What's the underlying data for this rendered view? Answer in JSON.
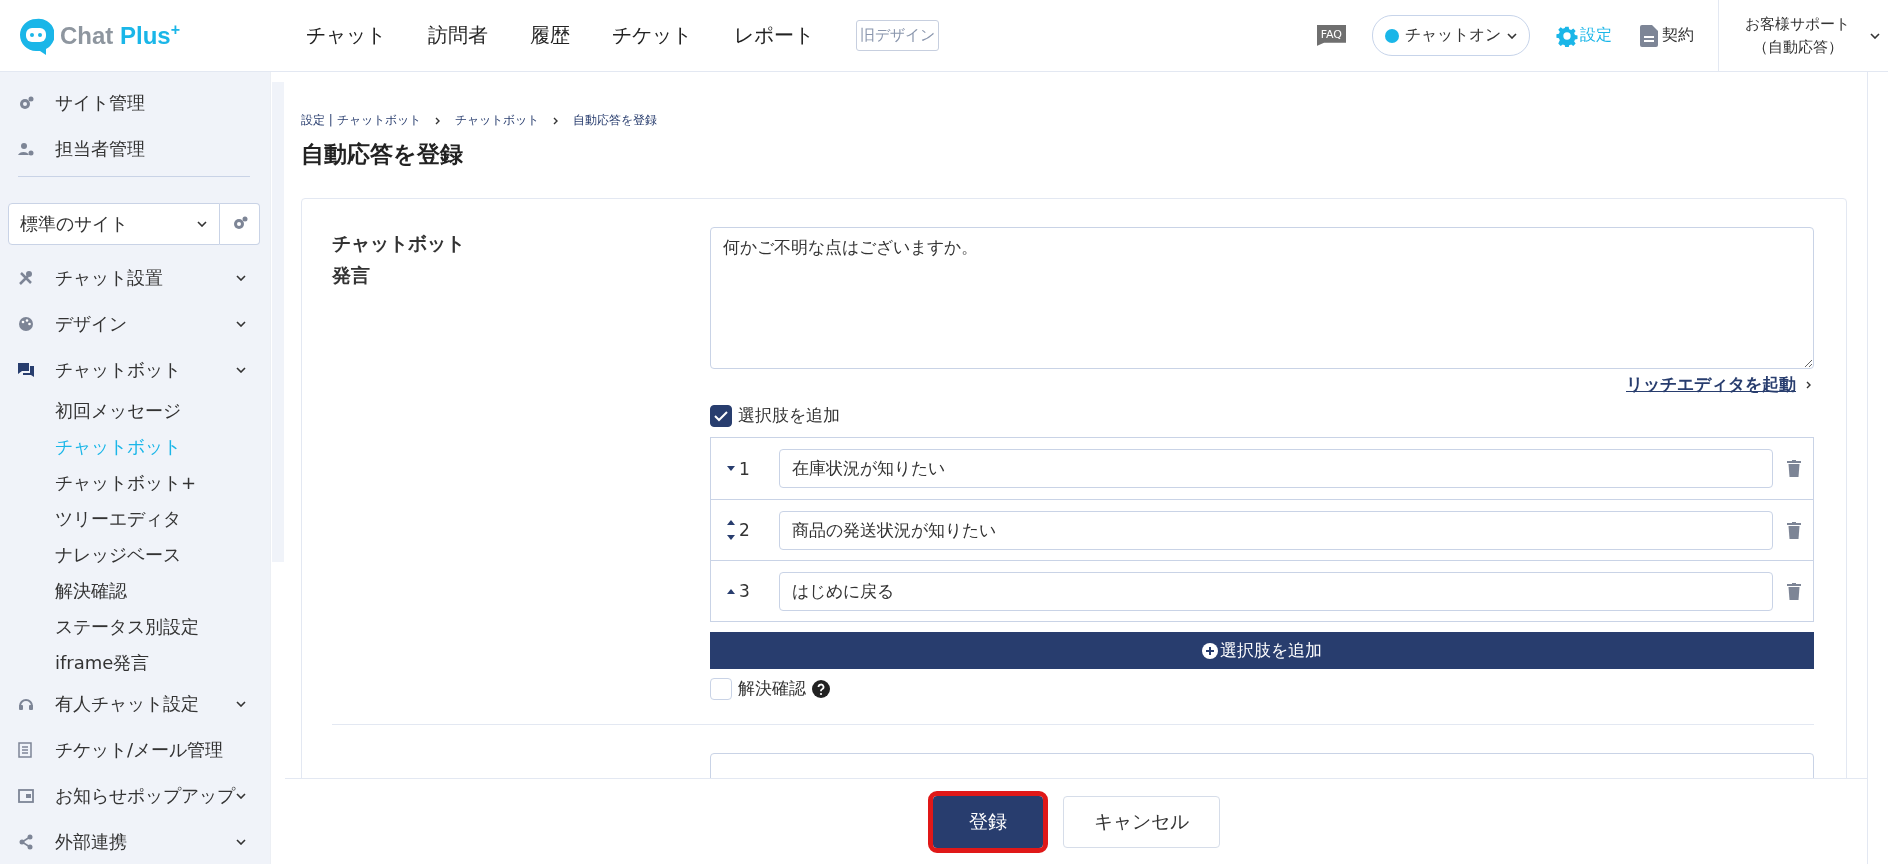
{
  "header": {
    "logo": {
      "text": "Chat Plus",
      "superscript": "+"
    },
    "nav": [
      {
        "label": "チャット"
      },
      {
        "label": "訪問者"
      },
      {
        "label": "履歴"
      },
      {
        "label": "チケット"
      },
      {
        "label": "レポート"
      }
    ],
    "old_design": "旧デザイン",
    "faq": "FAQ",
    "status": {
      "label": "チャットオン",
      "on": true
    },
    "settings": "設定",
    "contract": "契約",
    "user": {
      "line1": "お客様サポート",
      "line2": "（自動応答）"
    }
  },
  "sidebar": {
    "top_items": [
      {
        "label": "サイト管理",
        "kind": "gears"
      },
      {
        "label": "担当者管理",
        "kind": "user-gear"
      }
    ],
    "site_select": {
      "value": "標準のサイト"
    },
    "nav": [
      {
        "label": "チャット設置",
        "kind": "tools",
        "collapsible": true
      },
      {
        "label": "デザイン",
        "kind": "palette",
        "collapsible": true
      },
      {
        "label": "チャットボット",
        "kind": "chat",
        "collapsible": true,
        "children": [
          {
            "label": "初回メッセージ",
            "selected": false
          },
          {
            "label": "チャットボット",
            "selected": true
          },
          {
            "label": "チャットボット+",
            "selected": false
          },
          {
            "label": "ツリーエディタ",
            "selected": false
          },
          {
            "label": "ナレッジベース",
            "selected": false
          },
          {
            "label": "解決確認",
            "selected": false
          },
          {
            "label": "ステータス別設定",
            "selected": false
          },
          {
            "label": "iframe発言",
            "selected": false
          }
        ]
      },
      {
        "label": "有人チャット設定",
        "kind": "headset",
        "collapsible": true
      },
      {
        "label": "チケット/メール管理",
        "kind": "list",
        "collapsible": false
      },
      {
        "label": "お知らせポップアップ",
        "kind": "window",
        "collapsible": true
      },
      {
        "label": "外部連携",
        "kind": "share",
        "collapsible": true
      }
    ]
  },
  "main": {
    "breadcrumb": [
      "設定 | チャットボット",
      "チャットボット",
      "自動応答を登録"
    ],
    "title": "自動応答を登録",
    "form": {
      "label_lines": [
        "チャットボット",
        "発言"
      ],
      "message": "何かご不明な点はございますか。",
      "rich_editor_link": "リッチエディタを起動",
      "add_choices": {
        "label": "選択肢を追加",
        "checked": true
      },
      "choices": [
        {
          "number": "1",
          "value": "在庫状況が知りたい",
          "can_move_up": false,
          "can_move_down": true
        },
        {
          "number": "2",
          "value": "商品の発送状況が知りたい",
          "can_move_up": true,
          "can_move_down": true
        },
        {
          "number": "3",
          "value": "はじめに戻る",
          "can_move_up": true,
          "can_move_down": false
        }
      ],
      "add_button": "選択肢を追加",
      "resolve_check": {
        "label": "解決確認",
        "checked": false
      }
    }
  },
  "footer": {
    "buttons": [
      {
        "label": "登録",
        "kind": "primary",
        "highlighted": true
      },
      {
        "label": "キャンセル",
        "kind": "secondary",
        "highlighted": false
      }
    ]
  }
}
